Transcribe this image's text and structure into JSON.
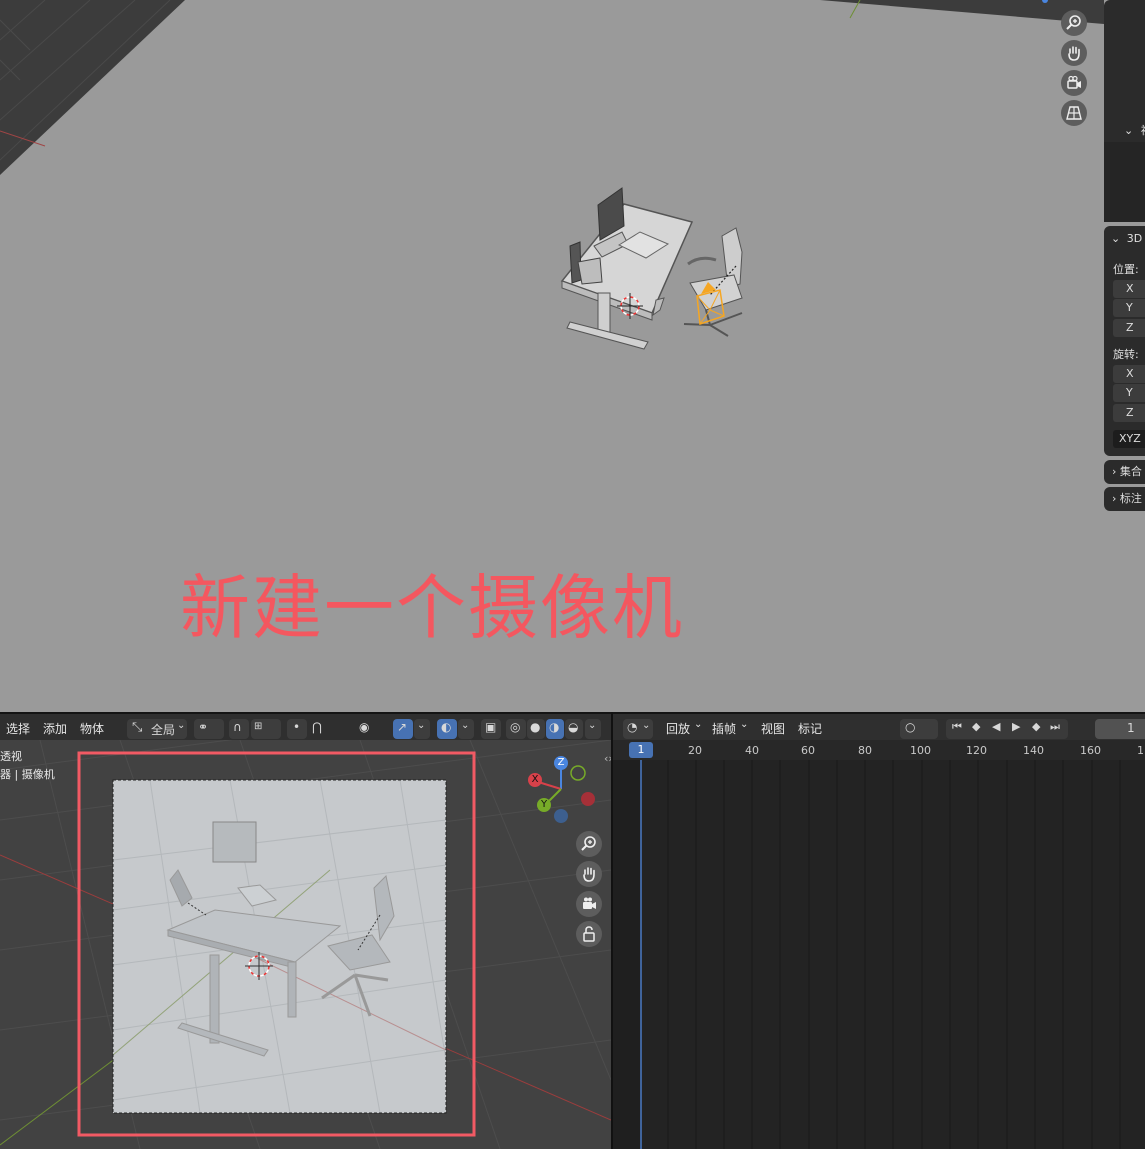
{
  "annotation_text": "新建一个摄像机",
  "n_panel": {
    "truncated_label": "视",
    "section_3d": "3D",
    "location_label": "位置:",
    "rotation_label": "旋转:",
    "axes": [
      "X",
      "Y",
      "Z"
    ],
    "rotation_mode": "XYZ",
    "collection_label": "集合",
    "annotation_label": "标注"
  },
  "bottom_viewport": {
    "menus": [
      "选择",
      "添加",
      "物体"
    ],
    "transform_orientation": "全局",
    "overlay_text_line1": "透视",
    "overlay_text_line2": "器 | 摄像机",
    "gizmo": {
      "z": "Z",
      "x": "X",
      "y": "Y"
    }
  },
  "timeline": {
    "menus": [
      "回放",
      "插帧",
      "视图",
      "标记"
    ],
    "current_frame": "1",
    "current_frame_field": "1",
    "ruler": [
      "20",
      "40",
      "60",
      "80",
      "100",
      "120",
      "140",
      "160",
      "1"
    ]
  },
  "colors": {
    "accent_blue": "#4772b3",
    "annotation_red": "#f4575f",
    "camera_orange": "#f5a623"
  }
}
